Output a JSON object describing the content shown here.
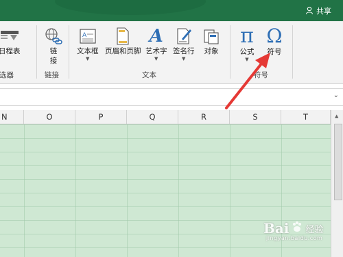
{
  "titlebar": {
    "share_label": "共享",
    "color": "#217346"
  },
  "ribbon": {
    "partial_filter_label": "日程表",
    "link_label_line1": "链",
    "link_label_line2": "接",
    "textbox_label": "文本框",
    "header_footer_label": "页眉和页脚",
    "wordart_label": "艺术字",
    "signature_label": "签名行",
    "object_label": "对象",
    "equation_label": "公式",
    "symbol_label": "符号",
    "equation_glyph": "π",
    "symbol_glyph": "Ω",
    "wordart_glyph": "A",
    "groups": {
      "filter_partial": "选器",
      "links": "链接",
      "text": "文本",
      "symbols": "符号"
    }
  },
  "columns": [
    "N",
    "O",
    "P",
    "Q",
    "R",
    "S",
    "T"
  ],
  "annotation": {
    "arrow_color": "#e53935"
  },
  "watermark": {
    "brand": "Bai",
    "brand2": "经验",
    "url": "jingyan.baidu.com"
  },
  "colors": {
    "grid_fill": "#cfe8d3",
    "ribbon_bg": "#f3f3f3"
  }
}
